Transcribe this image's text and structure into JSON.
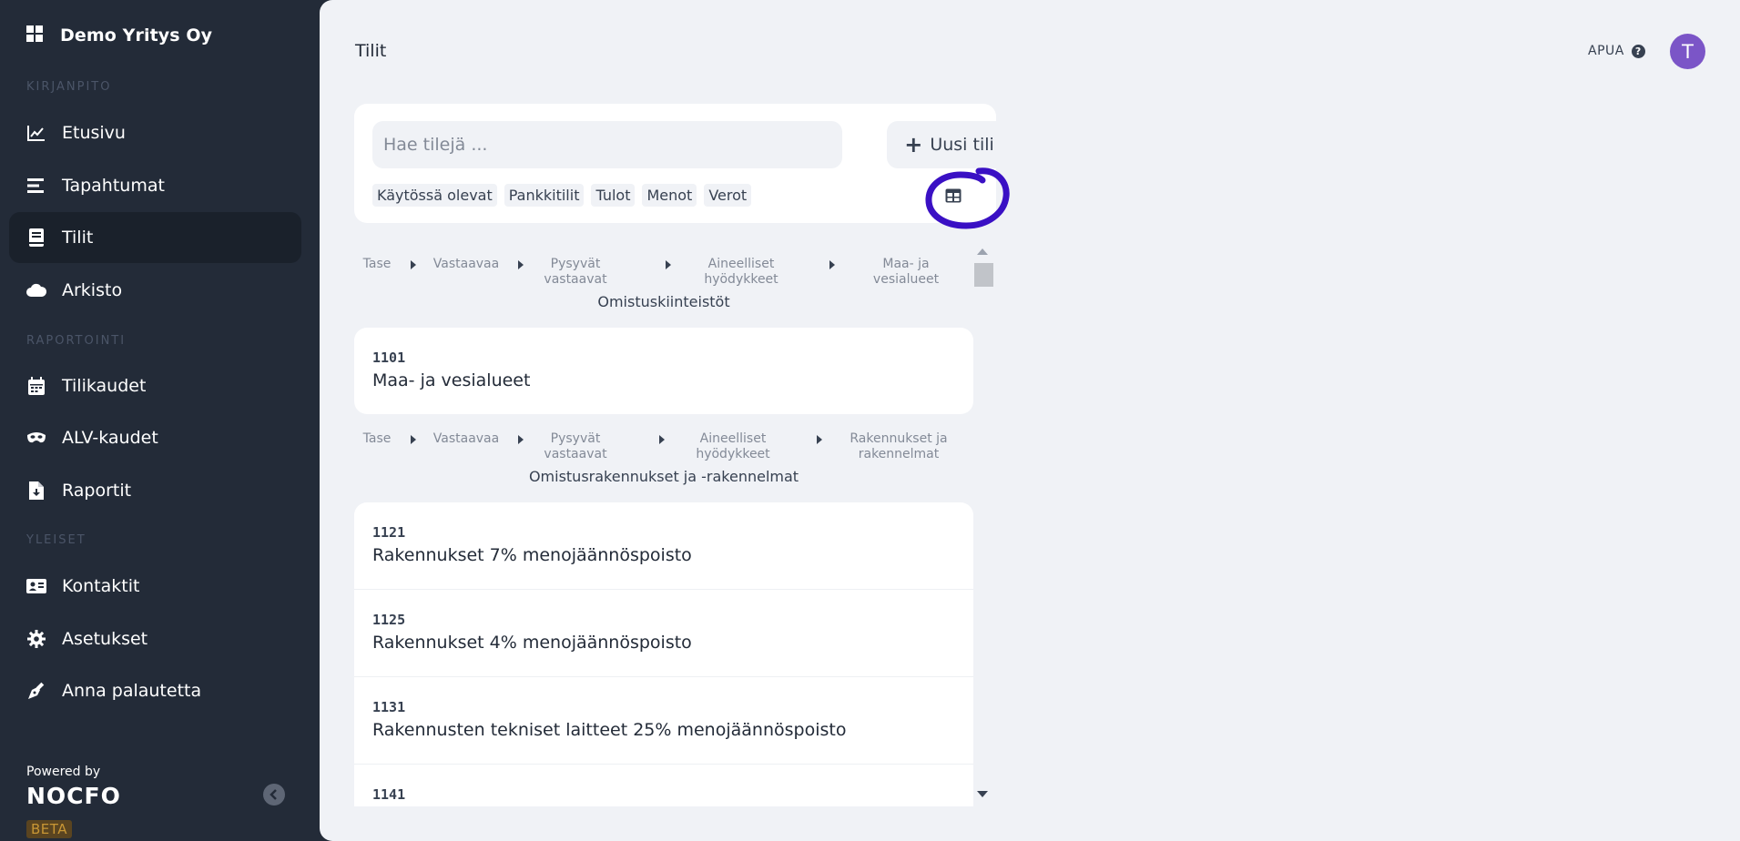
{
  "sidebar": {
    "company": "Demo Yritys Oy",
    "sections": {
      "kirjanpito": "KIRJANPITO",
      "raportointi": "RAPORTOINTI",
      "yleiset": "YLEISET"
    },
    "items": [
      {
        "label": "Etusivu",
        "icon": "chart-line-icon"
      },
      {
        "label": "Tapahtumat",
        "icon": "list-icon"
      },
      {
        "label": "Tilit",
        "icon": "book-icon",
        "active": true
      },
      {
        "label": "Arkisto",
        "icon": "cloud-icon"
      },
      {
        "label": "Tilikaudet",
        "icon": "calendar-icon"
      },
      {
        "label": "ALV-kaudet",
        "icon": "mask-icon"
      },
      {
        "label": "Raportit",
        "icon": "file-download-icon"
      },
      {
        "label": "Kontaktit",
        "icon": "id-card-icon"
      },
      {
        "label": "Asetukset",
        "icon": "gear-icon"
      },
      {
        "label": "Anna palautetta",
        "icon": "pen-nib-icon"
      }
    ],
    "powered_by": "Powered by",
    "logo": "NOCFO",
    "beta": "BETA"
  },
  "header": {
    "title": "Tilit",
    "help": "APUA",
    "avatar_initial": "T"
  },
  "search": {
    "placeholder": "Hae tilejä ...",
    "new_button": "Uusi tili",
    "filters": [
      "Käytössä olevat",
      "Pankkitilit",
      "Tulot",
      "Menot",
      "Verot"
    ]
  },
  "groups": [
    {
      "breadcrumb": [
        "Tase",
        "Vastaavaa",
        "Pysyvät vastaavat",
        "Aineelliset hyödykkeet",
        "Maa- ja vesialueet"
      ],
      "title": "Omistuskiinteistöt",
      "accounts": [
        {
          "number": "1101",
          "name": "Maa- ja vesialueet"
        }
      ]
    },
    {
      "breadcrumb": [
        "Tase",
        "Vastaavaa",
        "Pysyvät vastaavat",
        "Aineelliset hyödykkeet",
        "Rakennukset ja rakennelmat"
      ],
      "title": "Omistusrakennukset ja -rakennelmat",
      "accounts": [
        {
          "number": "1121",
          "name": "Rakennukset 7% menojäännöspoisto"
        },
        {
          "number": "1125",
          "name": "Rakennukset 4% menojäännöspoisto"
        },
        {
          "number": "1131",
          "name": "Rakennusten tekniset laitteet 25% menojäännöspoisto"
        },
        {
          "number": "1141",
          "name": ""
        }
      ]
    }
  ],
  "colors": {
    "sidebar_bg": "#232b38",
    "main_bg": "#f0f2f6",
    "avatar": "#7b55c7",
    "annotation": "#3a10c4"
  }
}
